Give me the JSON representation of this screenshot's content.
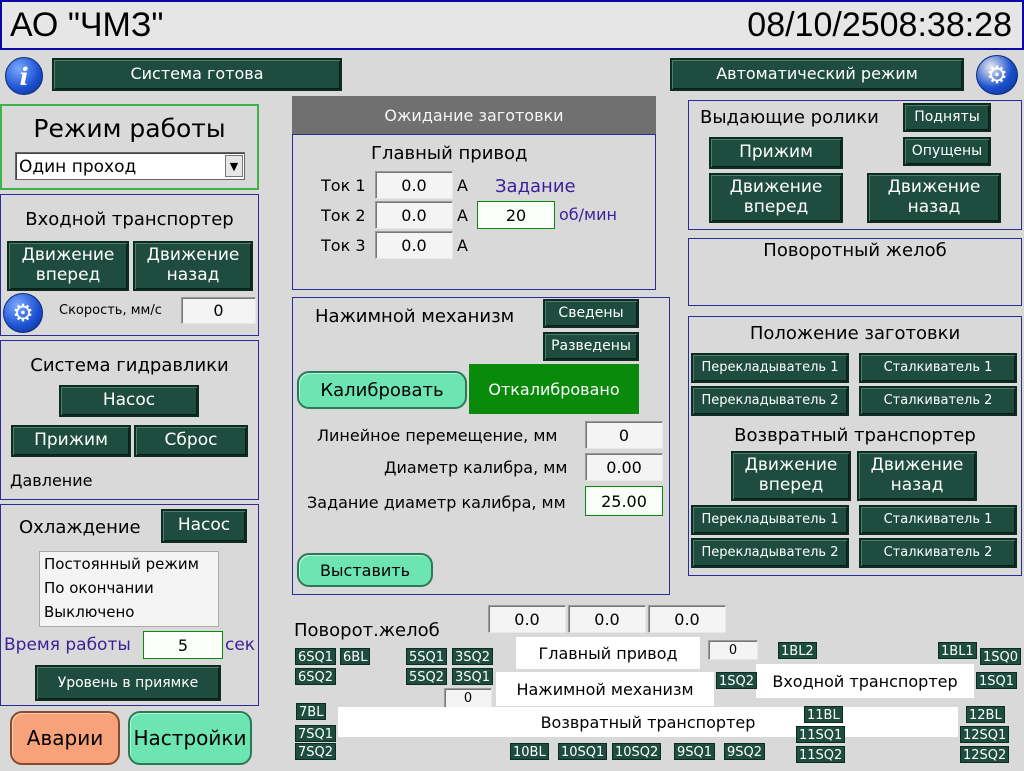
{
  "header": {
    "title": "АО \"ЧМЗ\"",
    "datetime": "08/10/2508:38:28"
  },
  "status": {
    "system": "Система готова",
    "mode": "Автоматический режим",
    "info_icon": "info-icon",
    "settings_icon": "gear-icon"
  },
  "work_mode": {
    "title": "Режим работы",
    "selected": "Один проход",
    "dropdown_arrow": "▼"
  },
  "input_conveyor": {
    "title": "Входной транспортер",
    "forward": "Движение вперед",
    "back": "Движение назад",
    "speed_label": "Скорость, мм/с",
    "speed_value": "0"
  },
  "hydraulics": {
    "title": "Система гидравлики",
    "pump": "Насос",
    "clamp": "Прижим",
    "reset": "Сброс",
    "pressure": "Давление"
  },
  "cooling": {
    "title": "Охлаждение",
    "pump": "Насос",
    "options": [
      "Постоянный режим",
      "По окончании",
      "Выключено"
    ],
    "time_label": "Время работы",
    "time_value": "5",
    "time_unit": "сек",
    "pit_level": "Уровень в приямке"
  },
  "bottom_buttons": {
    "alarms": "Аварии",
    "settings": "Настройки"
  },
  "waiting": {
    "label": "Ожидание заготовки"
  },
  "main_drive": {
    "title": "Главный привод",
    "currents": [
      {
        "label": "Ток 1",
        "value": "0.0",
        "unit": "А"
      },
      {
        "label": "Ток 2",
        "value": "0.0",
        "unit": "А"
      },
      {
        "label": "Ток 3",
        "value": "0.0",
        "unit": "А"
      }
    ],
    "setpoint_label": "Задание",
    "setpoint_value": "20",
    "setpoint_unit": "об/мин"
  },
  "press": {
    "title": "Нажимной механизм",
    "closed": "Сведены",
    "open": "Разведены",
    "calibrate": "Калибровать",
    "calibrated": "Откалибровано",
    "linear_label": "Линейное перемещение, мм",
    "linear_value": "0",
    "diameter_label": "Диаметр калибра, мм",
    "diameter_value": "0.00",
    "diameter_set_label": "Задание диаметр калибра, мм",
    "diameter_set_value": "25.00",
    "apply": "Выставить"
  },
  "output_rollers": {
    "title": "Выдающие ролики",
    "raised": "Подняты",
    "lowered": "Опущены",
    "clamp": "Прижим",
    "forward": "Движение вперед",
    "back": "Движение назад"
  },
  "chute": {
    "title": "Поворотный желоб"
  },
  "billet_position": {
    "title": "Положение заготовки",
    "shifter1": "Перекладыватель 1",
    "pusher1": "Сталкиватель 1",
    "shifter2": "Перекладыватель 2",
    "pusher2": "Сталкиватель 2",
    "return_title": "Возвратный транспортер",
    "return_forward": "Движение вперед",
    "return_back": "Движение назад",
    "rshifter1": "Перекладыватель 1",
    "rpusher1": "Сталкиватель 1",
    "rshifter2": "Перекладыватель 2",
    "rpusher2": "Сталкиватель 2"
  },
  "mimic": {
    "chute_label": "Поворот.желоб",
    "chute_values": [
      "0.0",
      "0.0",
      "0.0"
    ],
    "main_drive": "Главный привод",
    "main_drive_value": "0",
    "press": "Нажимной механизм",
    "press_value": "0",
    "input_conveyor": "Входной транспортер",
    "return_conveyor": "Возвратный транспортер",
    "sensors": {
      "s6SQ1": "6SQ1",
      "s6BL": "6BL",
      "s6SQ2": "6SQ2",
      "s5SQ1": "5SQ1",
      "s3SQ2": "3SQ2",
      "s5SQ2": "5SQ2",
      "s3SQ1": "3SQ1",
      "s1BL2": "1BL2",
      "s1BL1": "1BL1",
      "s1SQ0": "1SQ0",
      "s1SQ2": "1SQ2",
      "s1SQ1": "1SQ1",
      "s7BL": "7BL",
      "s7SQ1": "7SQ1",
      "s7SQ2": "7SQ2",
      "s11BL": "11BL",
      "s11SQ1": "11SQ1",
      "s11SQ2": "11SQ2",
      "s12BL": "12BL",
      "s12SQ1": "12SQ1",
      "s12SQ2": "12SQ2",
      "s10BL": "10BL",
      "s10SQ1": "10SQ1",
      "s10SQ2": "10SQ2",
      "s9SQ1": "9SQ1",
      "s9SQ2": "9SQ2"
    }
  },
  "colors": {
    "accent_green": "#1e4d3f",
    "calibrated_green": "#0a8a0a",
    "alarm_orange": "#f7a27a",
    "mint": "#6de5b2",
    "frame_blue": "#2b2b9a"
  }
}
